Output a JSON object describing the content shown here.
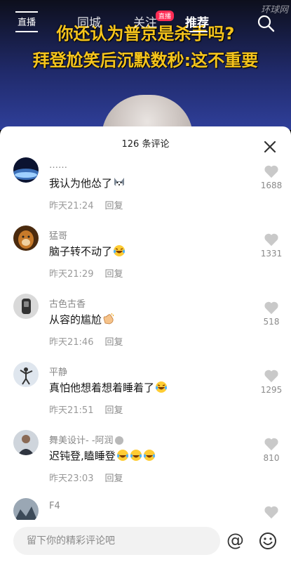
{
  "video": {
    "caption_line1": "你还认为普京是杀手吗?",
    "caption_line2": "拜登尬笑后沉默数秒:这不重要",
    "watermark": "环球网"
  },
  "topnav": {
    "live_label": "直播",
    "tabs": [
      "同城",
      "关注",
      "推荐"
    ],
    "live_badge": "直播",
    "active_tab": "推荐"
  },
  "comments_panel": {
    "title": "126 条评论",
    "comments": [
      {
        "user": "……",
        "text": "我认为他怂了",
        "time": "昨天21:24",
        "reply": "回复",
        "likes": "1688",
        "emojis": [
          "husky"
        ]
      },
      {
        "user": "猛哥",
        "text": "脑子转不动了",
        "time": "昨天21:29",
        "reply": "回复",
        "likes": "1331",
        "emojis": [
          "laugh-cry"
        ]
      },
      {
        "user": "古色古香",
        "text": "从容的尴尬",
        "time": "昨天21:46",
        "reply": "回复",
        "likes": "518",
        "emojis": [
          "clap"
        ]
      },
      {
        "user": "平静",
        "text": "真怕他想着想着睡着了",
        "time": "昨天21:51",
        "reply": "回复",
        "likes": "1295",
        "emojis": [
          "laugh-cry"
        ]
      },
      {
        "user": "舞美设计- -阿润",
        "text": "迟钝登,瞌睡登",
        "time": "昨天23:03",
        "reply": "回复",
        "likes": "810",
        "emojis": [
          "laugh-cry",
          "laugh-cry",
          "laugh-cry"
        ]
      },
      {
        "user": "F4",
        "text": "",
        "time": "",
        "reply": "",
        "likes": "",
        "emojis": []
      }
    ]
  },
  "bottom_bar": {
    "placeholder": "留下你的精彩评论吧",
    "at_symbol": "@"
  },
  "colors": {
    "caption": "#f5c41c",
    "accent": "#fe2c55",
    "muted_text": "#8a8a8a"
  }
}
